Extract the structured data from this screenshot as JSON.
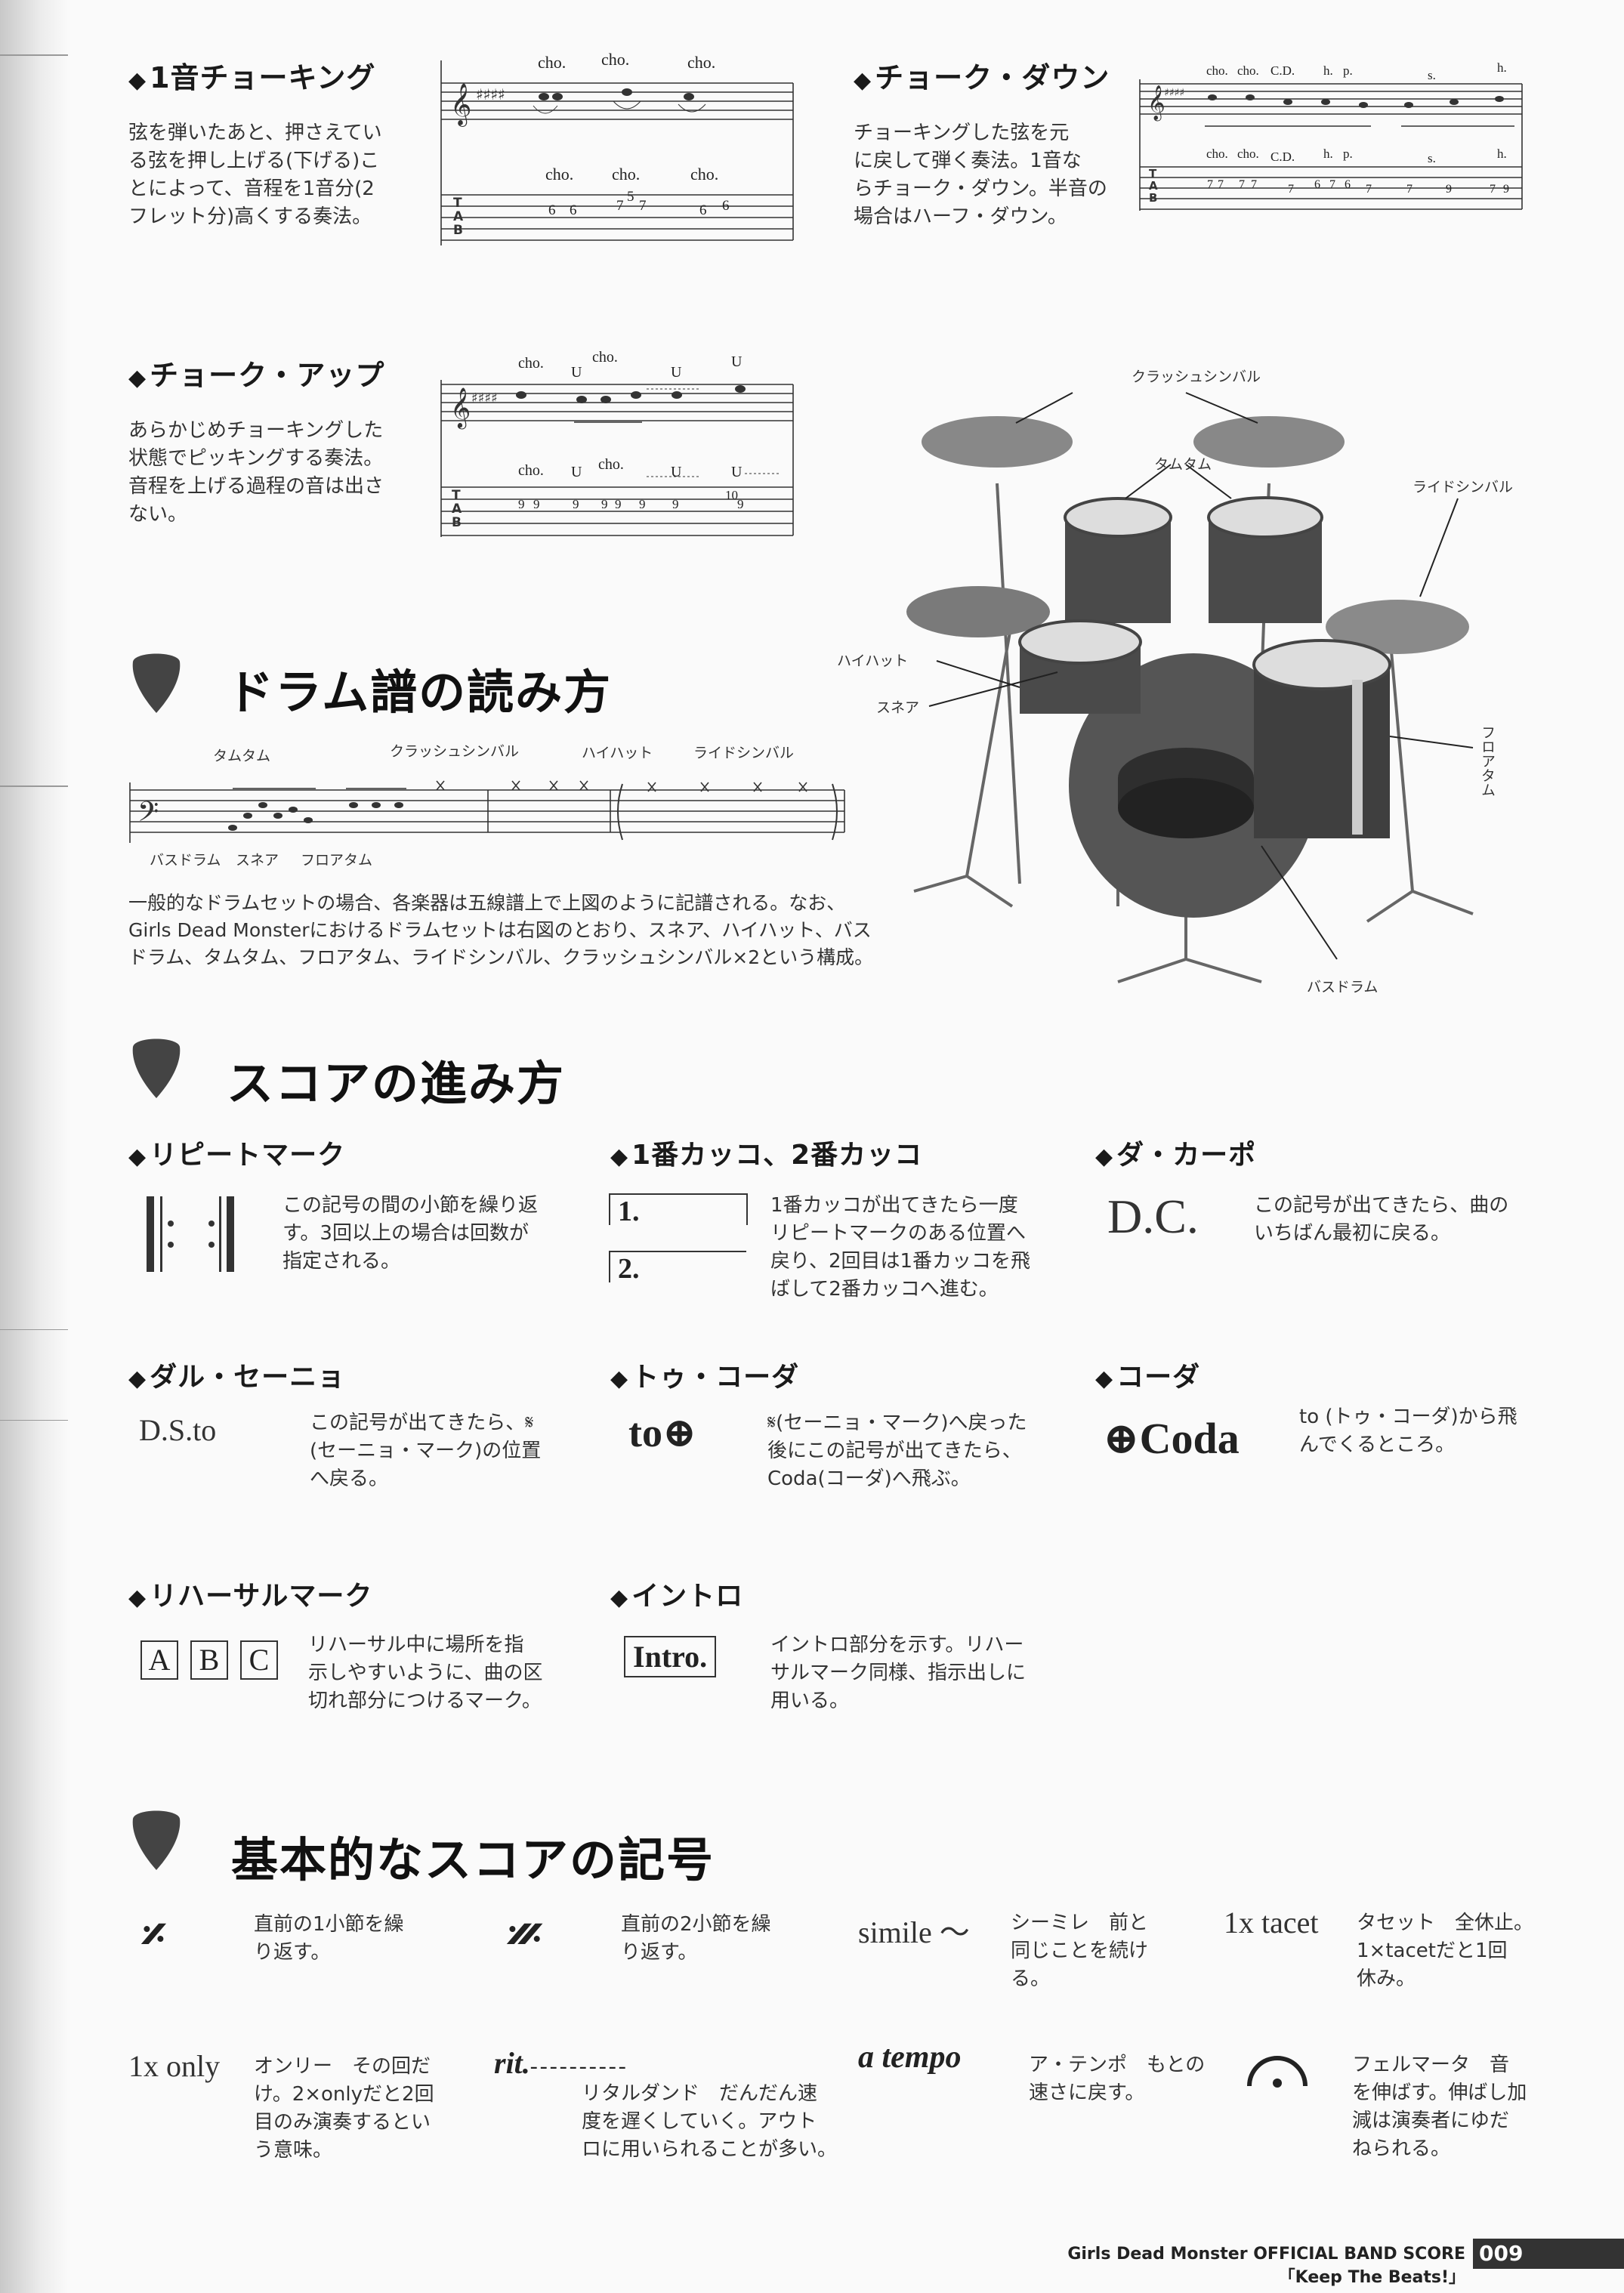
{
  "choking": {
    "title": "1音チョーキング",
    "body": [
      "弦を弾いたあと、押さえてい",
      "る弦を押し上げる(下げる)こ",
      "とによって、音程を1音分(2",
      "フレット分)高くする奏法。"
    ],
    "marks": [
      "cho.",
      "cho.",
      "cho."
    ],
    "tab_marks": [
      "cho.",
      "cho.",
      "cho."
    ],
    "tab_numbers": [
      "6",
      "6",
      "7",
      "5",
      "7",
      "6",
      "6"
    ]
  },
  "choke_down": {
    "title": "チョーク・ダウン",
    "body": [
      "チョーキングした弦を元",
      "に戻して弾く奏法。1音な",
      "らチョーク・ダウン。半音の",
      "場合はハーフ・ダウン。"
    ],
    "marks": [
      "cho.",
      "cho.",
      "C.D.",
      "h.",
      "p.",
      "s.",
      "h."
    ],
    "tab_marks": [
      "cho.",
      "cho.",
      "C.D.",
      "h.",
      "p.",
      "s.",
      "h."
    ],
    "tab_numbers": [
      "7",
      "7",
      "7",
      "7",
      "7",
      "6",
      "7",
      "6",
      "7",
      "7",
      "9",
      "7",
      "9"
    ]
  },
  "choke_up": {
    "title": "チョーク・アップ",
    "body": [
      "あらかじめチョーキングした",
      "状態でピッキングする奏法。",
      "音程を上げる過程の音は出さ",
      "ない。"
    ],
    "marks": [
      "cho.",
      "cho.",
      "U",
      "U",
      "U"
    ],
    "tab_marks": [
      "cho.",
      "U",
      "cho.",
      "U",
      "U"
    ],
    "tab_numbers": [
      "9",
      "9",
      "9",
      "9",
      "9",
      "9",
      "9",
      "10",
      "9"
    ]
  },
  "drum": {
    "title": "ドラム譜の読み方",
    "labels_top": [
      "タムタム",
      "クラッシュシンバル",
      "ハイハット",
      "ライドシンバル"
    ],
    "labels_bottom": [
      "バスドラム",
      "スネア",
      "フロアタム"
    ],
    "body": [
      "一般的なドラムセットの場合、各楽器は五線譜上で上図のように記譜される。なお、",
      "Girls Dead Monsterにおけるドラムセットは右図のとおり、スネア、ハイハット、バス",
      "ドラム、タムタム、フロアタム、ライドシンバル、クラッシュシンバル×2という構成。"
    ],
    "kit_labels": {
      "crash": "クラッシュシンバル",
      "tom": "タムタム",
      "ride": "ライドシンバル",
      "hihat": "ハイハット",
      "snare": "スネア",
      "floor": "フロアタム",
      "bass": "バスドラム"
    }
  },
  "score_flow": {
    "title": "スコアの進み方",
    "items": [
      {
        "title": "リピートマーク",
        "body": [
          "この記号の間の小節を繰り返",
          "す。3回以上の場合は回数が",
          "指定される。"
        ]
      },
      {
        "title": "1番カッコ、2番カッコ",
        "sym1": "1.",
        "sym2": "2.",
        "body": [
          "1番カッコが出てきたら一度",
          "リピートマークのある位置へ",
          "戻り、2回目は1番カッコを飛",
          "ばして2番カッコへ進む。"
        ]
      },
      {
        "title": "ダ・カーポ",
        "sym": "D.C.",
        "body": [
          "この記号が出てきたら、曲の",
          "いちばん最初に戻る。"
        ]
      },
      {
        "title": "ダル・セーニョ",
        "sym": "D.S.to",
        "body": [
          "この記号が出てきたら、𝄋",
          "(セーニョ・マーク)の位置",
          "へ戻る。"
        ]
      },
      {
        "title": "トゥ・コーダ",
        "sym": "to",
        "body": [
          "𝄋(セーニョ・マーク)へ戻った",
          "後にこの記号が出てきたら、",
          "Coda(コーダ)へ飛ぶ。"
        ]
      },
      {
        "title": "コーダ",
        "sym": "Coda",
        "body": [
          "to (トゥ・コーダ)から飛",
          "んでくるところ。"
        ]
      },
      {
        "title": "リハーサルマーク",
        "letters": [
          "A",
          "B",
          "C"
        ],
        "body": [
          "リハーサル中に場所を指",
          "示しやすいように、曲の区",
          "切れ部分につけるマーク。"
        ]
      },
      {
        "title": "イントロ",
        "sym": "Intro.",
        "body": [
          "イントロ部分を示す。リハー",
          "サルマーク同様、指示出しに",
          "用いる。"
        ]
      }
    ]
  },
  "basic": {
    "title": "基本的なスコアの記号",
    "items": [
      {
        "sym": "𝄎",
        "body": [
          "直前の1小節を繰",
          "り返す。"
        ]
      },
      {
        "sym": "𝄏",
        "body": [
          "直前の2小節を繰",
          "り返す。"
        ]
      },
      {
        "sym": "simile ～",
        "body": [
          "シーミレ　前と",
          "同じことを続け",
          "る。"
        ]
      },
      {
        "sym": "1x tacet",
        "body": [
          "タセット　全休止。",
          "1×tacetだと1回",
          "休み。"
        ]
      },
      {
        "sym": "1x only",
        "body": [
          "オンリー　その回だ",
          "け。2×onlyだと2回",
          "目のみ演奏するとい",
          "う意味。"
        ]
      },
      {
        "sym": "rit.",
        "dash": "----------",
        "body": [
          "リタルダンド　だんだん速",
          "度を遅くしていく。アウト",
          "ロに用いられることが多い。"
        ]
      },
      {
        "sym": "a tempo",
        "body": [
          "ア・テンポ　もとの",
          "速さに戻す。"
        ]
      },
      {
        "sym": "𝄐",
        "body": [
          "フェルマータ　音",
          "を伸ばす。伸ばし加",
          "減は演奏者にゆだ",
          "ねられる。"
        ]
      }
    ]
  },
  "footer": {
    "text": "Girls Dead Monster  OFFICIAL BAND SCORE「Keep The Beats!」",
    "page": "009"
  }
}
